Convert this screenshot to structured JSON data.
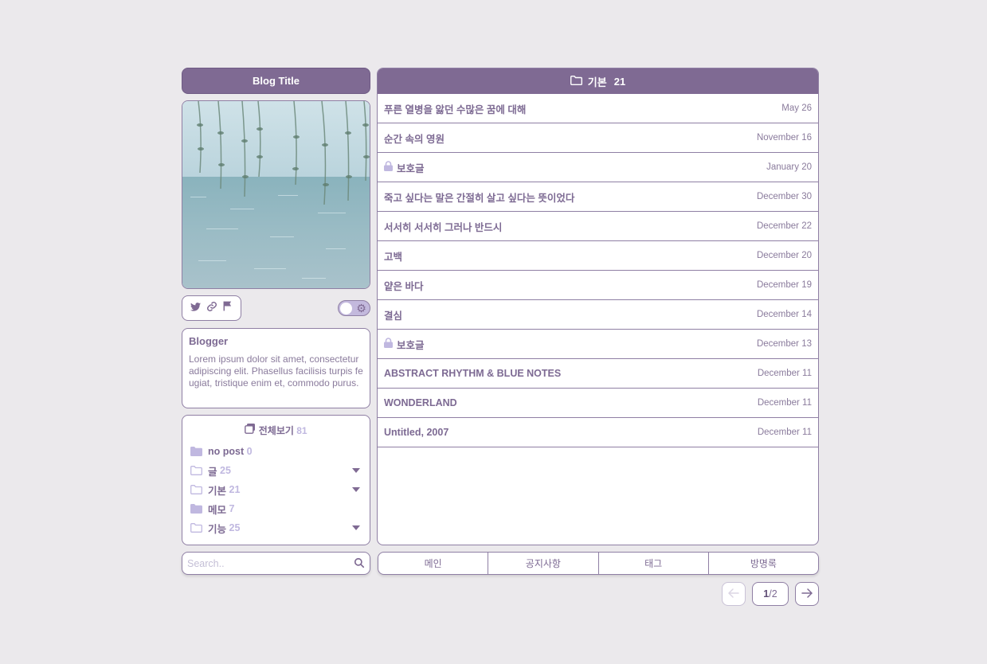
{
  "sidebar": {
    "blog_title": "Blog Title",
    "social_icons": [
      "twitter-icon",
      "link-icon",
      "flag-icon"
    ],
    "theme_toggle_icon": "gear-icon",
    "profile": {
      "name": "Blogger",
      "description": "Lorem ipsum dolor sit amet, consectetur adipiscing elit. Phasellus facilisis turpis feugiat, tristique enim et, commodo purus."
    },
    "categories": {
      "all_label": "전체보기",
      "all_count": "81",
      "items": [
        {
          "label": "no post",
          "count": "0",
          "icon": "folder-filled-icon",
          "expandable": false
        },
        {
          "label": "글",
          "count": "25",
          "icon": "folder-outline-icon",
          "expandable": true
        },
        {
          "label": "기본",
          "count": "21",
          "icon": "folder-outline-icon",
          "expandable": true
        },
        {
          "label": "메모",
          "count": "7",
          "icon": "folder-filled-icon",
          "expandable": false
        },
        {
          "label": "기능",
          "count": "25",
          "icon": "folder-outline-icon",
          "expandable": true
        }
      ]
    },
    "search": {
      "placeholder": "Search.."
    }
  },
  "main": {
    "header": {
      "label": "기본",
      "count": "21"
    },
    "posts": [
      {
        "title": "푸른 열병을 앓던 수많은 꿈에 대해",
        "date": "May 26",
        "locked": false
      },
      {
        "title": "순간 속의 영원",
        "date": "November 16",
        "locked": false
      },
      {
        "title": "보호글",
        "date": "January 20",
        "locked": true
      },
      {
        "title": "죽고 싶다는 말은 간절히 살고 싶다는 뜻이었다",
        "date": "December 30",
        "locked": false
      },
      {
        "title": "서서히 서서히 그러나 반드시",
        "date": "December 22",
        "locked": false
      },
      {
        "title": "고백",
        "date": "December 20",
        "locked": false
      },
      {
        "title": "얕은 바다",
        "date": "December 19",
        "locked": false
      },
      {
        "title": "결심",
        "date": "December 14",
        "locked": false
      },
      {
        "title": "보호글",
        "date": "December 13",
        "locked": true
      },
      {
        "title": "ABSTRACT RHYTHM & BLUE NOTES",
        "date": "December 11",
        "locked": false
      },
      {
        "title": "WONDERLAND",
        "date": "December 11",
        "locked": false
      },
      {
        "title": "Untitled, 2007",
        "date": "December 11",
        "locked": false
      }
    ]
  },
  "nav": {
    "items": [
      "메인",
      "공지사항",
      "태그",
      "방명록"
    ]
  },
  "pagination": {
    "current": "1",
    "separator": "/",
    "total": "2"
  },
  "colors": {
    "accent": "#7f6a93",
    "background": "#ebe9ec",
    "count": "#c0b8e0"
  }
}
